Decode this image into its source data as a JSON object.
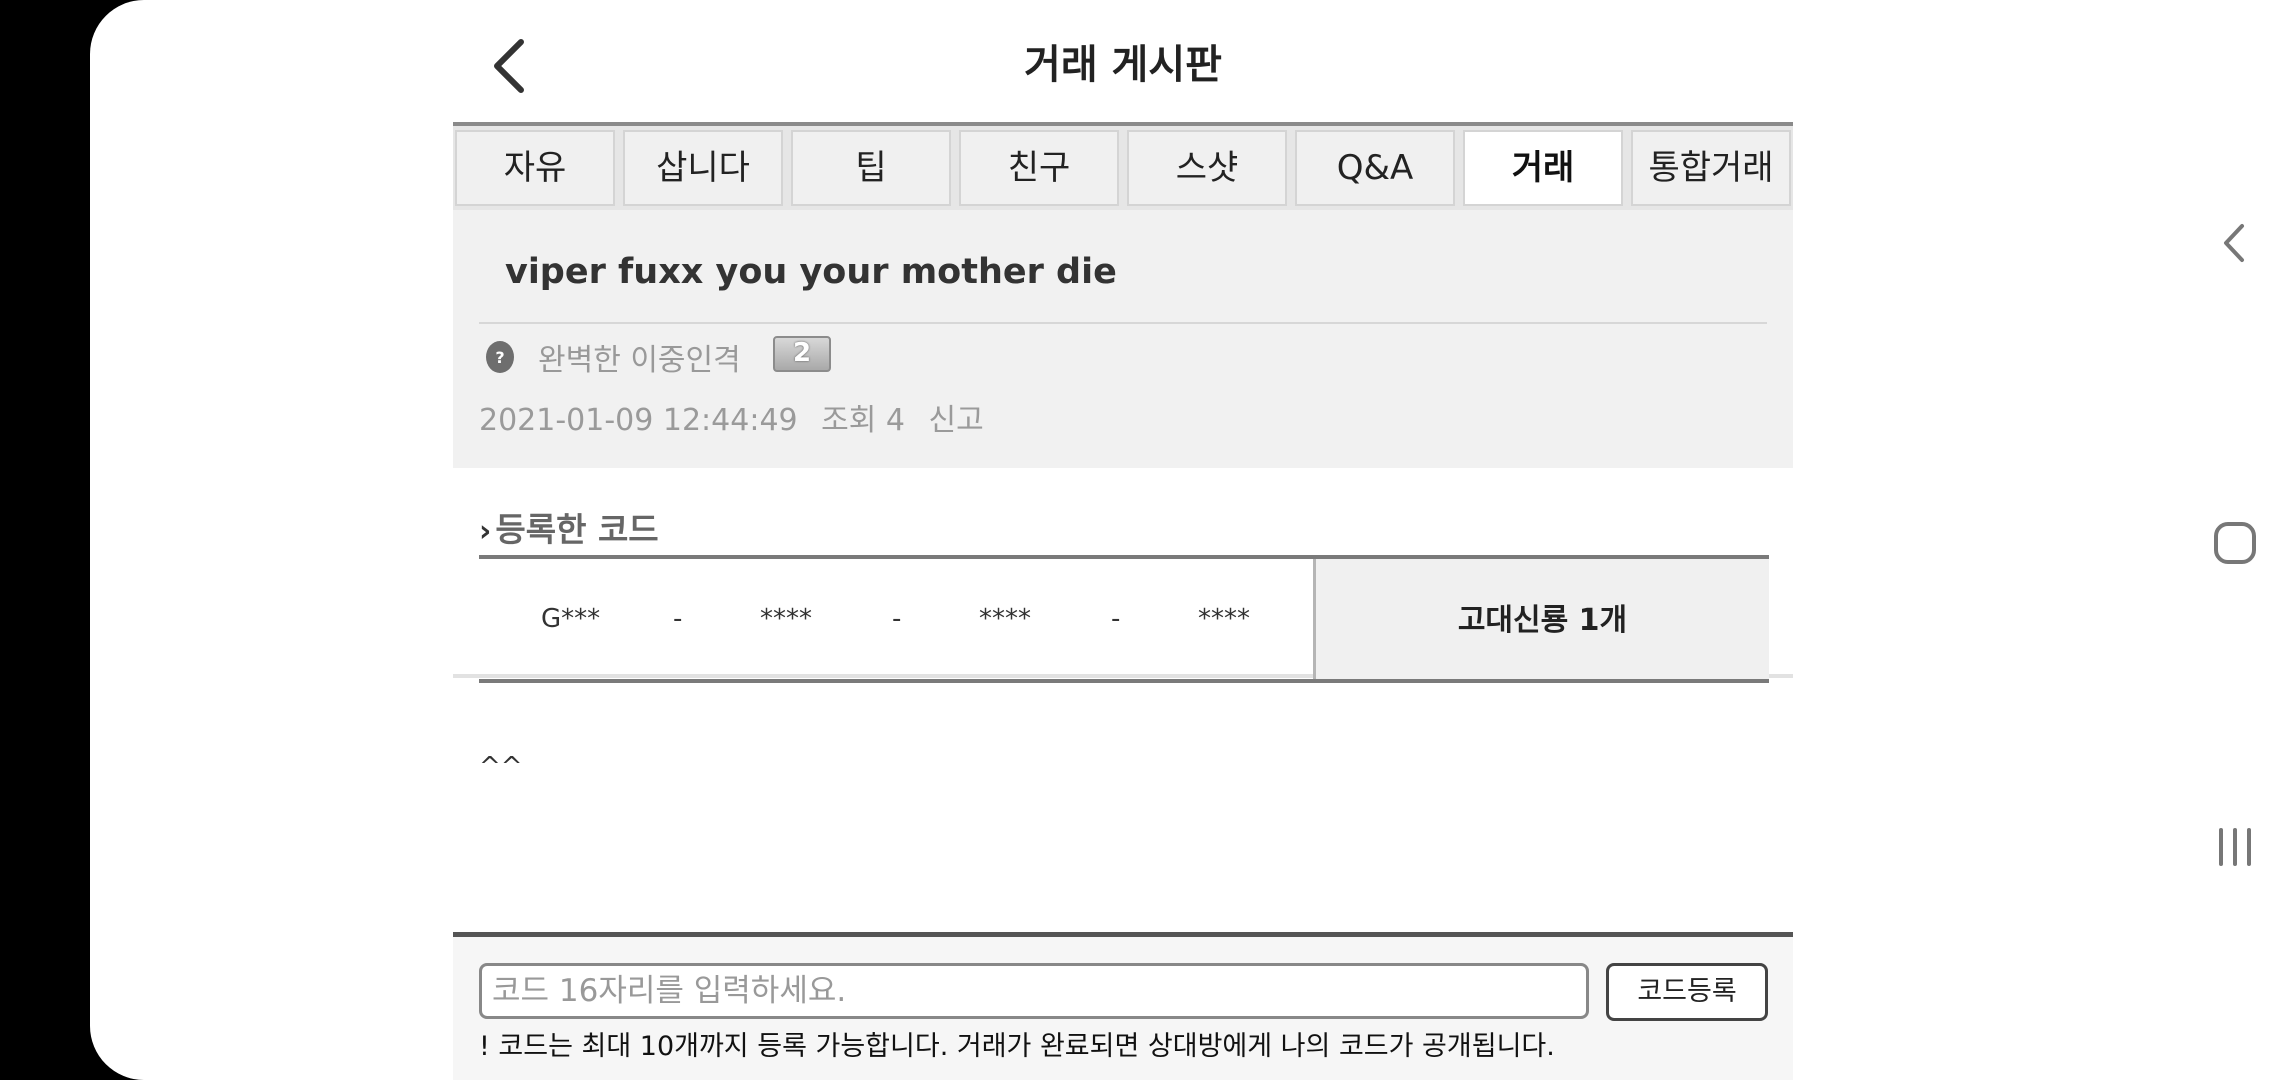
{
  "header": {
    "title": "거래 게시판",
    "back_icon": "chevron-left-icon"
  },
  "tabs": [
    {
      "label": "자유",
      "active": false
    },
    {
      "label": "삽니다",
      "active": false
    },
    {
      "label": "팁",
      "active": false
    },
    {
      "label": "친구",
      "active": false
    },
    {
      "label": "스샷",
      "active": false
    },
    {
      "label": "Q&A",
      "active": false
    },
    {
      "label": "거래",
      "active": true
    },
    {
      "label": "통합거래",
      "active": false
    }
  ],
  "post": {
    "title": "viper fuxx you your mother die",
    "author": "완벽한 이중인격",
    "level": "2",
    "date": "2021-01-09 12:44:49",
    "views": "조회 4",
    "report": "신고",
    "body": "^^"
  },
  "codes": {
    "section_title": "등록한 코드",
    "parts": [
      "G***",
      "-",
      "****",
      "-",
      "****",
      "-",
      "****"
    ],
    "reward": "고대신룡 1개"
  },
  "register": {
    "placeholder": "코드 16자리를 입력하세요.",
    "button_label": "코드등록",
    "notice": "! 코드는 최대 10개까지 등록 가능합니다. 거래가 완료되면 상대방에게 나의 코드가 공개됩니다."
  },
  "system_nav": [
    "back-icon",
    "home-icon",
    "recents-icon"
  ]
}
